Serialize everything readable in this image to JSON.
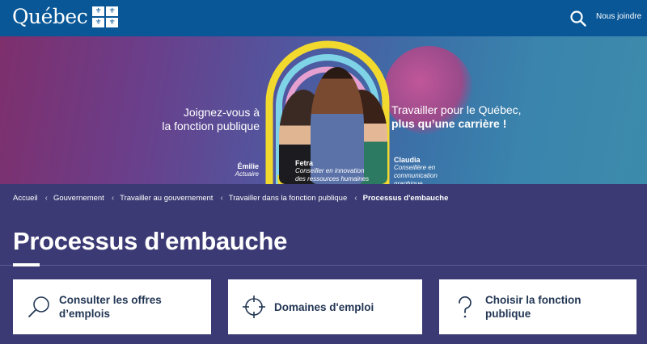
{
  "header": {
    "logo_text": "Québec",
    "search_icon": "search-icon",
    "contact_label": "Nous joindre"
  },
  "banner": {
    "tagline_left": [
      "Joignez-vous à",
      "la fonction publique"
    ],
    "tagline_right": [
      "Travailler pour le Québec,",
      "plus qu’une carrière !"
    ],
    "people": [
      {
        "name": "Émilie",
        "role": [
          "Actuaire"
        ]
      },
      {
        "name": "Fetra",
        "role": [
          "Conseiller en innovation",
          "des ressources humaines"
        ]
      },
      {
        "name": "Claudia",
        "role": [
          "Conseillère en",
          "communication graphique"
        ]
      }
    ]
  },
  "breadcrumb": [
    "Accueil",
    "Gouvernement",
    "Travailler au gouvernement",
    "Travailler dans la fonction publique",
    "Processus d'embauche"
  ],
  "page": {
    "title": "Processus d'embauche"
  },
  "cards": [
    {
      "label": [
        "Consulter les offres",
        "d’emplois"
      ],
      "icon": "search-icon"
    },
    {
      "label": [
        "Domaines d'emploi"
      ],
      "icon": "target-icon"
    },
    {
      "label": [
        "Choisir la fonction",
        "publique"
      ],
      "icon": "question-icon"
    }
  ],
  "colors": {
    "header": "#095797",
    "page_bg": "#3b3a74",
    "card_text": "#223654"
  }
}
